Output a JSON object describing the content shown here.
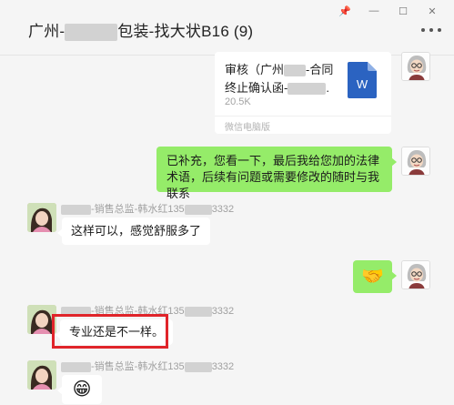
{
  "window": {
    "controls": [
      "📌",
      "—",
      "☐",
      "✕"
    ]
  },
  "header": {
    "title_prefix": "广州-",
    "title_suffix": "包装-找大状B16 (9)"
  },
  "messages": {
    "file": {
      "title": "审核（广州",
      "title_mid": "-合同",
      "title_line2": "终止确认函-",
      "title_end": ".",
      "size": "20.5K",
      "source": "微信电脑版",
      "icon": "word-doc-icon",
      "icon_letter": "W"
    },
    "me_text": "已补充，您看一下，最后我给您加的法律术语，后续有问题或需要修改的随时与我联系",
    "sender1_prefix": "-销售总监-韩水红135",
    "sender1_suffix": "3332",
    "reply1": "这样可以，感觉舒服多了",
    "me_emoji": "🤝",
    "sender2_prefix": "-销售总监-韩水红135",
    "sender2_suffix": "3332",
    "reply2": "专业还是不一样。",
    "sender3_prefix": "-销售总监-韩水红135",
    "sender3_suffix": "3332",
    "reply3_emoji": "😁"
  },
  "colors": {
    "my_bubble": "#95ec69",
    "their_bubble": "#ffffff",
    "highlight": "#e0242a"
  }
}
